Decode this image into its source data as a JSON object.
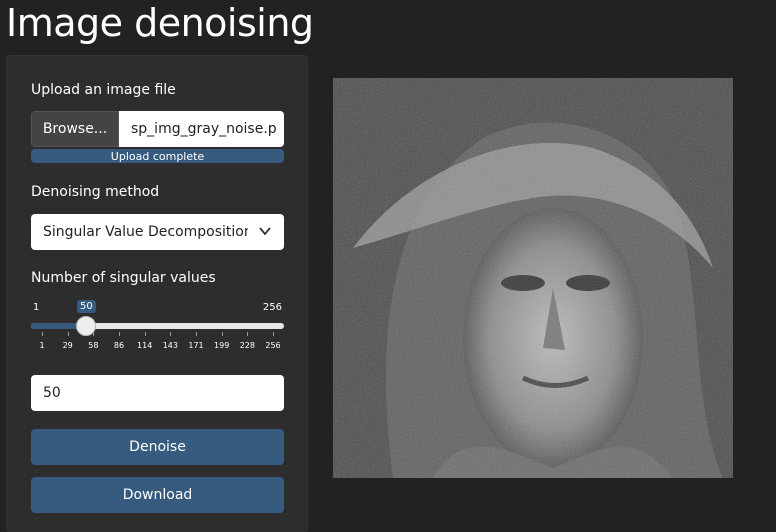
{
  "title": "Image denoising",
  "upload": {
    "label": "Upload an image file",
    "browse_label": "Browse...",
    "file_name": "sp_img_gray_noise.p",
    "progress_text": "Upload complete",
    "progress_fraction": 1.0
  },
  "method": {
    "label": "Denoising method",
    "selected": "Singular Value Decomposition"
  },
  "singular": {
    "label": "Number of singular values",
    "min": 1,
    "max": 256,
    "value": 50,
    "value_label": "50",
    "min_label": "1",
    "max_label": "256",
    "ticks": [
      "1",
      "29",
      "58",
      "86",
      "114",
      "143",
      "171",
      "199",
      "228",
      "256"
    ]
  },
  "number_input": {
    "value": "50"
  },
  "buttons": {
    "denoise": "Denoise",
    "download": "Download"
  },
  "colors": {
    "accent": "#375a7f",
    "background": "#222222",
    "sidebar": "#2d2d2d"
  }
}
